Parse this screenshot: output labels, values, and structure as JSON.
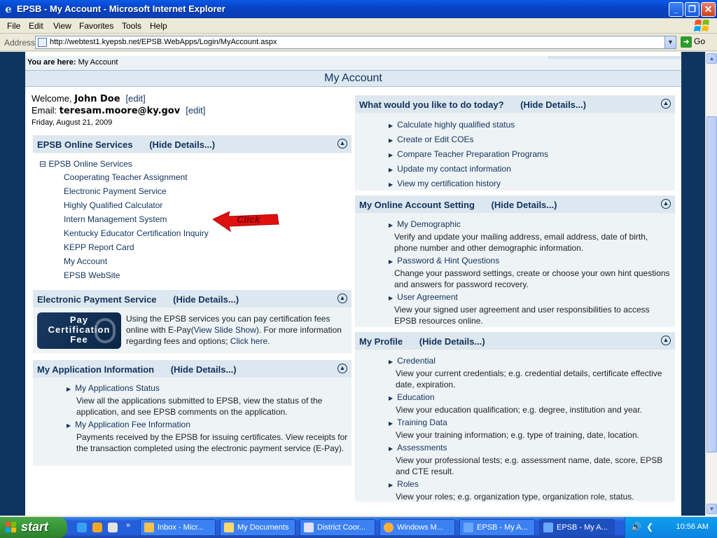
{
  "window": {
    "title": "EPSB - My Account - Microsoft Internet Explorer",
    "minimize": "_",
    "maximize": "❐",
    "close": "✕"
  },
  "menu": [
    "File",
    "Edit",
    "View",
    "Favorites",
    "Tools",
    "Help"
  ],
  "address": {
    "label": "Address",
    "url": "http://webtest1.kyepsb.net/EPSB.WebApps/Login/MyAccount.aspx",
    "go_label": "Go"
  },
  "breadcrumb": {
    "prefix": "You are here:",
    "current": "My Account"
  },
  "page_title": "My Account",
  "welcome": {
    "welcome_prefix": "Welcome,",
    "name": "John Doe",
    "edit": "[edit]",
    "email_prefix": "Email:",
    "email": "teresam.moore@ky.gov",
    "date": "Friday, August 21, 2009"
  },
  "online_services": {
    "title": "EPSB Online Services",
    "hide": "(Hide Details...)",
    "tree_root": "EPSB Online Services",
    "tree_toggle": "⊟",
    "items": [
      "Cooperating Teacher Assignment",
      "Electronic Payment Service",
      "Highly Qualified Calculator",
      "Intern Management System",
      "Kentucky Educator Certification Inquiry",
      "KEPP Report Card",
      "My Account",
      "EPSB WebSite"
    ],
    "arrow_label": "Click"
  },
  "payment": {
    "title": "Electronic Payment Service",
    "hide": "(Hide Details...)",
    "logo_lines": [
      "Pay",
      "Certification",
      "Fee"
    ],
    "text_1": "Using the EPSB services you can pay certification fees online with E-Pay",
    "slide_link": "(View Slide Show)",
    "text_2": ". For more information regarding fees and options; ",
    "click_here": "Click here."
  },
  "application": {
    "title": "My Application Information",
    "hide": "(Hide Details...)",
    "items": [
      {
        "label": "My Applications Status",
        "desc": "View all the applications submitted to EPSB, view the status of the application, and see EPSB comments on the application."
      },
      {
        "label": "My Application Fee Information",
        "desc": "Payments received by the EPSB for issuing certificates. View receipts for the transaction completed using the electronic payment service (E-Pay)."
      }
    ]
  },
  "today": {
    "title": "What would you like to do today?",
    "hide": "(Hide Details...)",
    "items": [
      "Calculate highly qualified status",
      "Create or Edit COEs",
      "Compare Teacher Preparation Programs",
      "Update my contact information",
      "View my certification history"
    ]
  },
  "account_setting": {
    "title": "My Online Account Setting",
    "hide": "(Hide Details...)",
    "items": [
      {
        "label": "My Demographic",
        "desc": "Verify and update your mailing address, email address, date of birth, phone number and other demographic information."
      },
      {
        "label": "Password & Hint Questions",
        "desc": "Change your password settings, create or choose your own hint questions and answers for password recovery."
      },
      {
        "label": "User Agreement",
        "desc": "View your signed user agreement and user responsibilities to access EPSB resources online."
      }
    ]
  },
  "profile": {
    "title": "My Profile",
    "hide": "(Hide Details...)",
    "items": [
      {
        "label": "Credential",
        "desc": "View your current credentials; e.g. credential details, certificate effective date, expiration."
      },
      {
        "label": "Education",
        "desc": "View your education qualification; e.g. degree, institution and year."
      },
      {
        "label": "Training Data",
        "desc": "View your training information; e.g. type of training, date, location."
      },
      {
        "label": "Assessments",
        "desc": "View your professional tests; e.g. assessment name, date, score, EPSB and CTE result."
      },
      {
        "label": "Roles",
        "desc": "View your roles; e.g. organization type, organization role, status."
      }
    ]
  },
  "taskbar": {
    "start": "start",
    "tasks": [
      "Inbox - Micr...",
      "My Documents",
      "District Coor...",
      "Windows M...",
      "EPSB - My A...",
      "EPSB - My A..."
    ],
    "clock": "10:56 AM"
  }
}
